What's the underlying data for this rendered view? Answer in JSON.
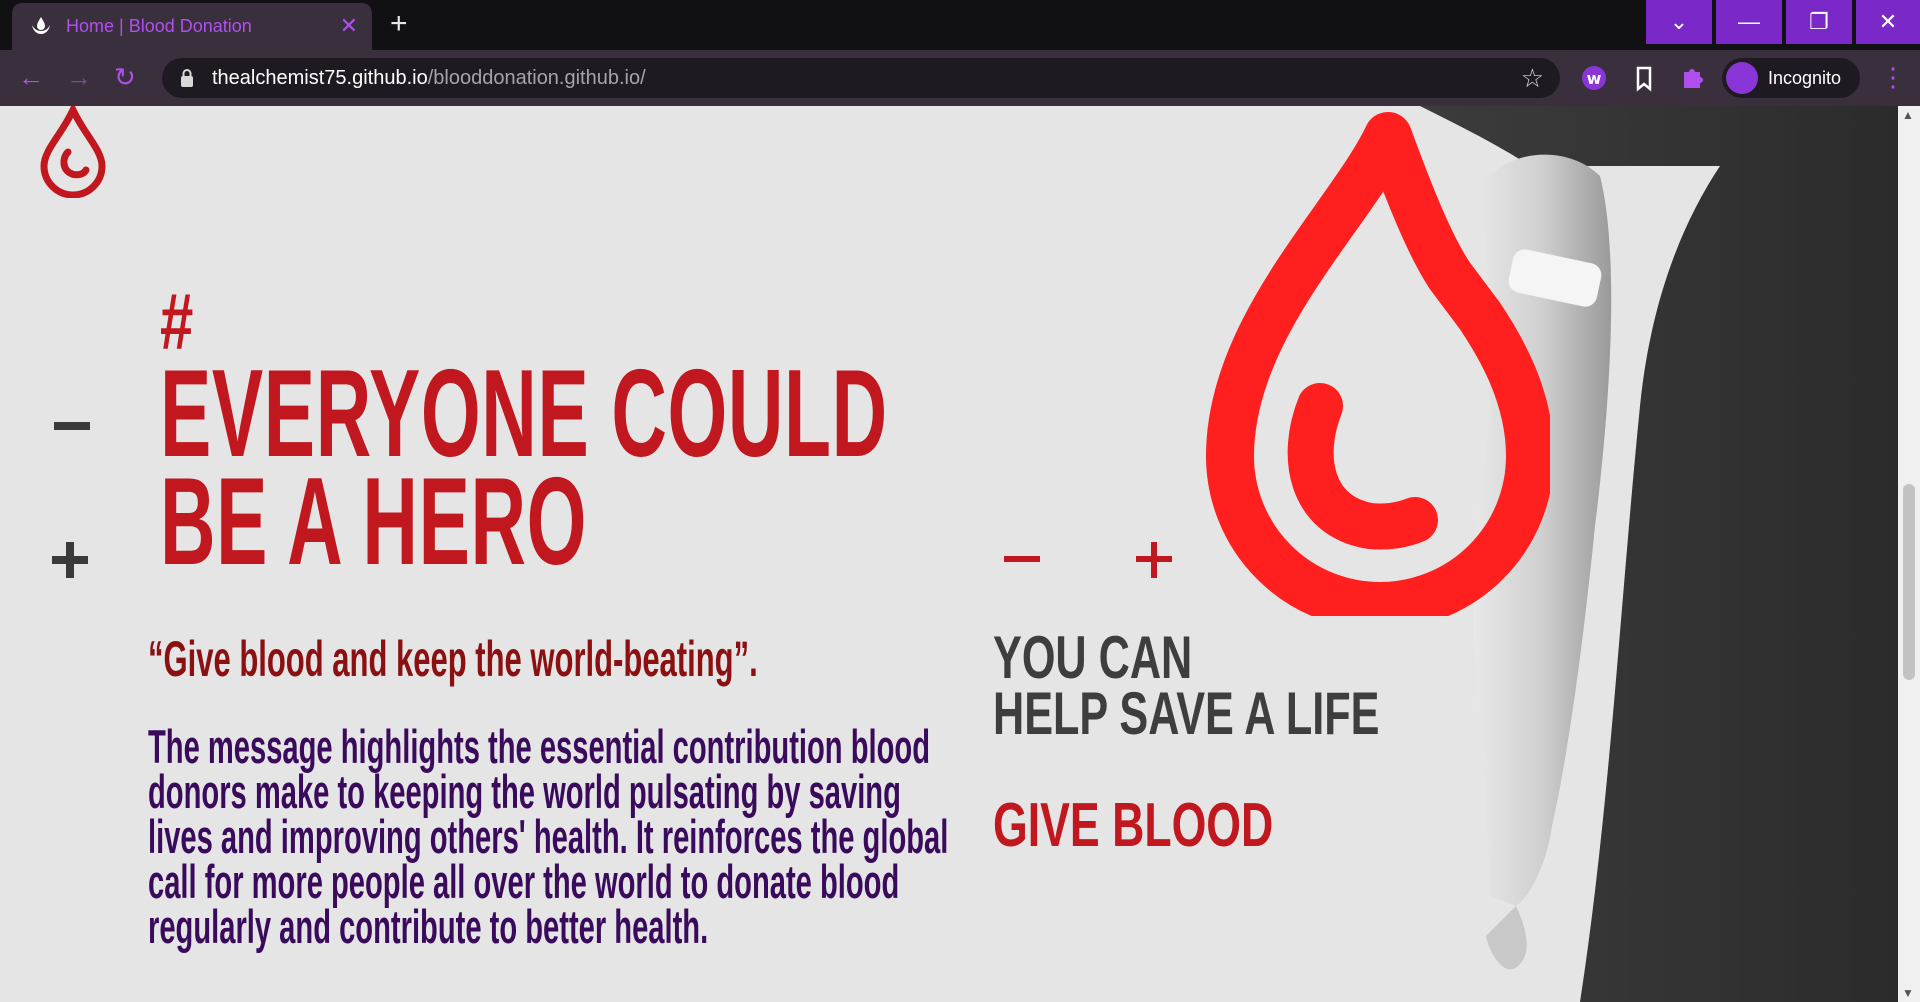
{
  "browser": {
    "tab_title": "Home | Blood Donation",
    "tab_close": "✕",
    "new_tab": "+",
    "url_host": "thealchemist75.github.io",
    "url_path": "/blooddonation.github.io/",
    "profile_label": "Incognito",
    "window_controls": [
      "⌄",
      "—",
      "❐",
      "✕"
    ],
    "nav": {
      "back": "←",
      "forward": "→",
      "reload": "↻"
    },
    "star": "☆",
    "menu": "⋮"
  },
  "page": {
    "hash": "#",
    "headline_line1": "EVERYONE COULD",
    "headline_line2": "BE A HERO",
    "quote": "“Give blood and keep the world-beating”.",
    "message": "The message highlights the essential contribution blood donors make to keeping the world pulsating by saving lives and improving others' health. It reinforces the global call for more people all over the world to donate blood regularly and contribute to better health.",
    "you_can_line1": "YOU CAN",
    "you_can_line2": "HELP SAVE A LIFE",
    "give_blood": "GIVE BLOOD"
  },
  "colors": {
    "brand_red": "#c0181e",
    "drop_red": "#ff1f1f",
    "quote_red": "#8a1011",
    "message_purple": "#3a0b5c",
    "chrome_accent": "#b04ff0",
    "window_button": "#7a28c8"
  },
  "icons": [
    "blood-drop-logo-icon",
    "lock-icon",
    "star-icon",
    "extension-icon",
    "bookmark-icon",
    "incognito-icon"
  ]
}
